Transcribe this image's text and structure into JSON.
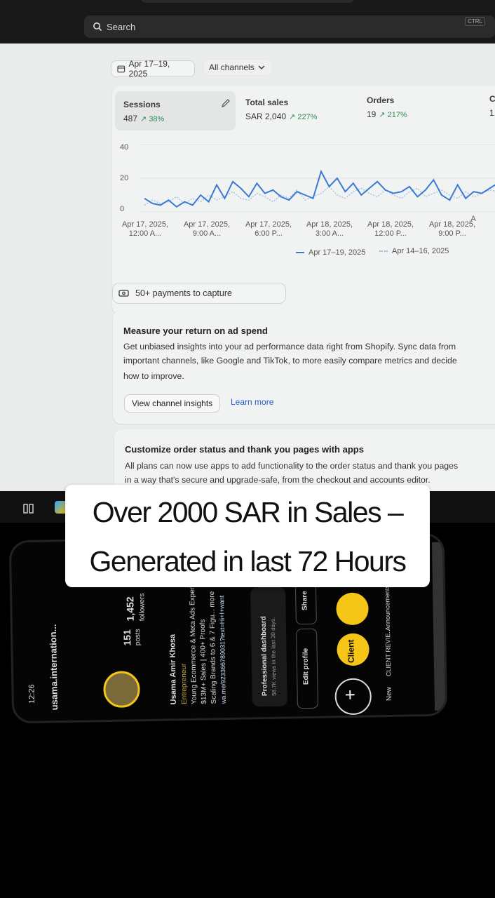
{
  "search": {
    "placeholder": "Search",
    "ctrl": "CTRL"
  },
  "filters": {
    "date_range": "Apr 17–19, 2025",
    "channels": "All channels"
  },
  "metrics": [
    {
      "label": "Sessions",
      "value": "487",
      "change": "↗ 38%"
    },
    {
      "label": "Total sales",
      "value": "SAR 2,040",
      "change": "↗ 227%"
    },
    {
      "label": "Orders",
      "value": "19",
      "change": "↗ 217%"
    },
    {
      "label": "C",
      "value": "1."
    }
  ],
  "chart_data": {
    "type": "line",
    "yticks": [
      "20",
      "0"
    ],
    "ytop": "40",
    "x_labels": [
      "Apr 17, 2025, 12:00 A...",
      "Apr 17, 2025, 9:00 A...",
      "Apr 17, 2025, 6:00 P...",
      "Apr 18, 2025, 3:00 A...",
      "Apr 18, 2025, 12:00 P...",
      "Apr 18, 2025, 9:00 P...",
      "A"
    ],
    "ylim": [
      0,
      40
    ],
    "series": [
      {
        "name": "Apr 17–19, 2025",
        "values": [
          8,
          5,
          4,
          7,
          3,
          6,
          4,
          10,
          6,
          16,
          8,
          18,
          14,
          9,
          17,
          11,
          13,
          9,
          7,
          12,
          10,
          8,
          24,
          15,
          20,
          12,
          17,
          10,
          14,
          18,
          13,
          11,
          12,
          15,
          9,
          13,
          19,
          10,
          7,
          16,
          8,
          12,
          11,
          14,
          17
        ]
      },
      {
        "name": "Apr 14–16, 2025",
        "values": [
          4,
          7,
          5,
          6,
          9,
          5,
          8,
          6,
          10,
          7,
          9,
          12,
          8,
          7,
          11,
          9,
          6,
          10,
          8,
          13,
          7,
          9,
          11,
          15,
          10,
          8,
          12,
          14,
          11,
          9,
          13,
          10,
          8,
          12,
          14,
          9,
          11,
          13,
          10,
          8,
          12,
          9,
          11,
          13,
          12
        ]
      }
    ],
    "colors": {
      "current": "#3a7bd5",
      "previous": "#9dbbe6"
    }
  },
  "payments": {
    "label": "50+ payments to capture"
  },
  "ad_card": {
    "title": "Measure your return on ad spend",
    "body_lines": [
      "Get unbiased insights into your ad performance data right from Shopify. Sync data from",
      "important channels, like Google and TikTok, to more easily compare metrics and decide",
      "how to improve."
    ],
    "button": "View channel insights",
    "link": "Learn more"
  },
  "order_card": {
    "title": "Customize order status and thank you pages with apps",
    "body_lines": [
      "All plans can now use apps to add functionality to the order status and thank you pages",
      "in a way that's secure and upgrade-safe, from the checkout and accounts editor."
    ]
  },
  "caption": {
    "line1": "Over 2000 SAR in Sales –",
    "line2": "Generated in last 72 Hours"
  },
  "phone": {
    "username": "usama.internation...",
    "posts": "151",
    "posts_label": "posts",
    "followers": "1,452",
    "followers_label": "followers",
    "name": "Usama Amir Khosa",
    "role": "Entrepreneur",
    "bio1": "Young Ecommerce & Meta Ads Expert",
    "bio2": "$13M+ Sales | 400+ Proofs",
    "bio3": "Scaling Brands to 6 & 7 Figu... more",
    "bio4": "wa.me/923366789031?text=Hi+I+want",
    "dash_title": "Professional dashboard",
    "dash_sub": "58.7K views in the last 30 days.",
    "edit": "Edit profile",
    "share": "Share",
    "new": "New",
    "client": "Client",
    "client_rev": "CLIENT REVIE...",
    "announce": "Announcements",
    "time": "12:26"
  },
  "colors": {
    "accent": "#1f5fd1",
    "positive": "#2e8b57",
    "caption_bg": "#ffffff",
    "story_ring": "#f5c518"
  }
}
